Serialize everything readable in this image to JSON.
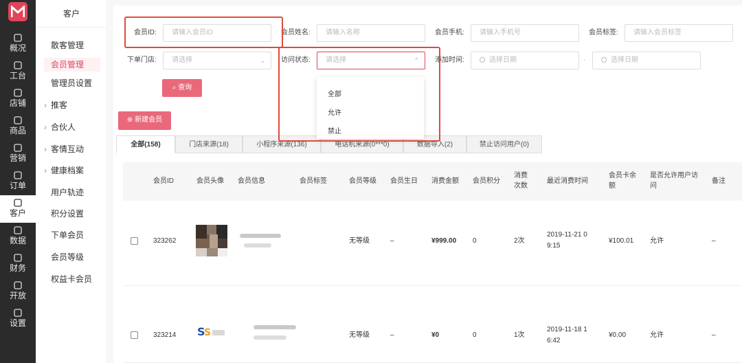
{
  "rail": {
    "items": [
      {
        "label": "概况",
        "icon": "overview-icon"
      },
      {
        "label": "工台",
        "icon": "desk-icon"
      },
      {
        "label": "店铺",
        "icon": "store-icon"
      },
      {
        "label": "商品",
        "icon": "goods-icon"
      },
      {
        "label": "营销",
        "icon": "marketing-icon"
      },
      {
        "label": "订单",
        "icon": "order-icon"
      },
      {
        "label": "客户",
        "icon": "customer-icon"
      },
      {
        "label": "数据",
        "icon": "data-icon"
      },
      {
        "label": "财务",
        "icon": "finance-icon"
      },
      {
        "label": "开放",
        "icon": "open-icon"
      },
      {
        "label": "设置",
        "icon": "settings-icon"
      }
    ],
    "active": "客户"
  },
  "sidebar": {
    "title": "客户",
    "items": [
      {
        "label": "散客管理"
      },
      {
        "label": "会员管理"
      },
      {
        "label": "管理员设置"
      },
      {
        "label": "推客"
      },
      {
        "label": "合伙人"
      },
      {
        "label": "客情互动"
      },
      {
        "label": "健康档案"
      },
      {
        "label": "用户轨迹"
      },
      {
        "label": "积分设置"
      },
      {
        "label": "下单会员"
      },
      {
        "label": "会员等级"
      },
      {
        "label": "权益卡会员"
      }
    ]
  },
  "filters": {
    "member_id": {
      "label": "会员ID:",
      "placeholder": "请输入会员ID"
    },
    "member_name": {
      "label": "会员姓名:",
      "placeholder": "请输入名称"
    },
    "member_phone": {
      "label": "会员手机:",
      "placeholder": "请输入手机号"
    },
    "member_tag": {
      "label": "会员标签:",
      "placeholder": "请输入会员标签"
    },
    "store": {
      "label": "下单门店:",
      "placeholder": "请选择"
    },
    "visit_status": {
      "label": "访问状态:",
      "placeholder": "请选择"
    },
    "add_time": {
      "label": "添加时间:",
      "start_placeholder": "选择日期",
      "end_placeholder": "选择日期",
      "separator": "-"
    },
    "query_button": "查询"
  },
  "visit_dropdown": {
    "options": [
      "全部",
      "允许",
      "禁止"
    ]
  },
  "new_member_button": "新建会员",
  "tabs": [
    {
      "label": "全部(158)"
    },
    {
      "label": "门店来源(18)"
    },
    {
      "label": "小程序来源(136)"
    },
    {
      "label": "电话机来源(0***0)"
    },
    {
      "label": "数据导入(2)"
    },
    {
      "label": "禁止访问用户(0)"
    }
  ],
  "table": {
    "headers": [
      "会员ID",
      "会员头像",
      "会员信息",
      "会员标签",
      "会员等级",
      "会员生日",
      "消费金额",
      "会员积分",
      "消费次数",
      "最近消费时间",
      "会员卡余额",
      "是否允许用户访问",
      "备注"
    ],
    "rows": [
      {
        "id": "323262",
        "level": "无等级",
        "birthday": "–",
        "amount": "¥999.00",
        "points": "0",
        "count": "2次",
        "last_time_1": "2019-11-21 0",
        "last_time_2": "9:15",
        "balance": "¥100.01",
        "access": "允许",
        "note": "–"
      },
      {
        "id": "323214",
        "level": "无等级",
        "birthday": "–",
        "amount": "¥0",
        "points": "0",
        "count": "1次",
        "last_time_1": "2019-11-18 1",
        "last_time_2": "6:42",
        "balance": "¥0.00",
        "access": "允许",
        "note": "–"
      }
    ]
  },
  "colors": {
    "accent": "#e0455a",
    "highlight_box": "#e04a3a",
    "rail_bg": "#2b2b2b"
  }
}
